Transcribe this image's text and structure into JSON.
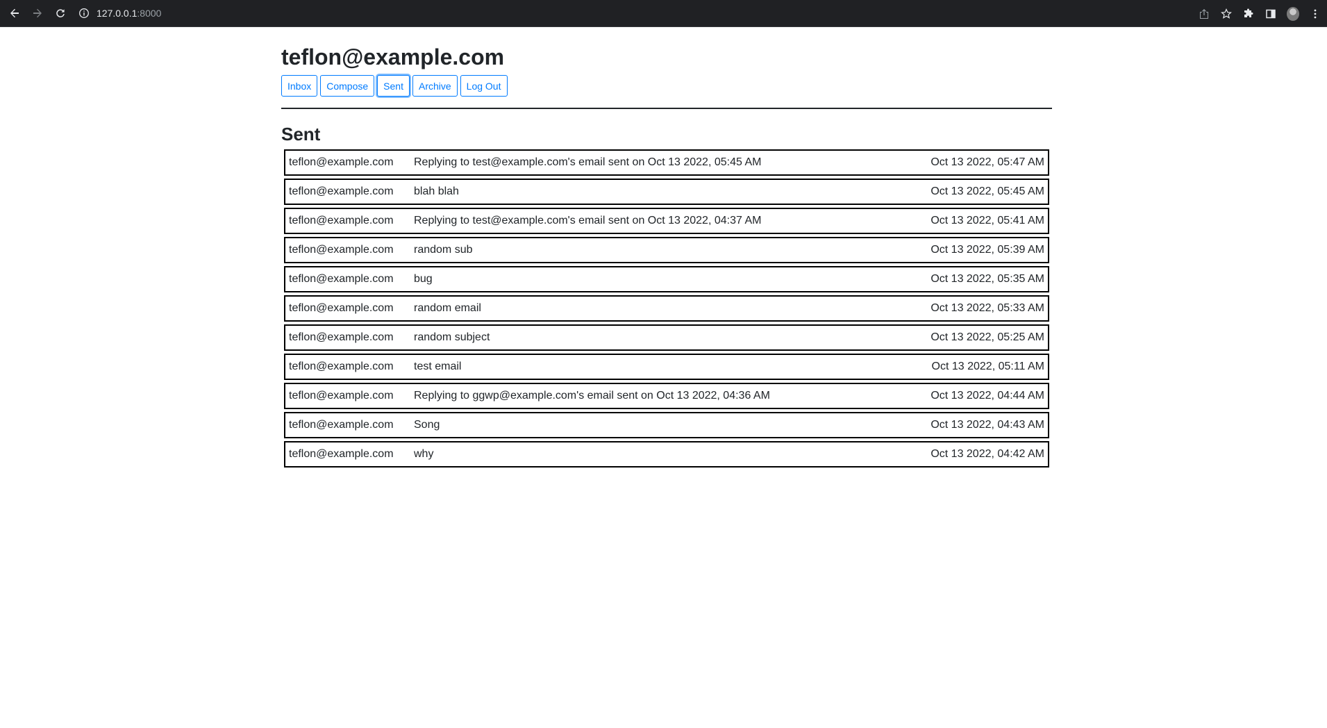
{
  "browser": {
    "url_host": "127.0.0.1",
    "url_port": ":8000"
  },
  "header": {
    "user_email": "teflon@example.com"
  },
  "nav": {
    "inbox": "Inbox",
    "compose": "Compose",
    "sent": "Sent",
    "archive": "Archive",
    "logout": "Log Out",
    "active": "sent"
  },
  "mailbox": {
    "title": "Sent",
    "emails": [
      {
        "sender": "teflon@example.com",
        "subject": "Replying to test@example.com's email sent on Oct 13 2022, 05:45 AM",
        "timestamp": "Oct 13 2022, 05:47 AM"
      },
      {
        "sender": "teflon@example.com",
        "subject": "blah blah",
        "timestamp": "Oct 13 2022, 05:45 AM"
      },
      {
        "sender": "teflon@example.com",
        "subject": "Replying to test@example.com's email sent on Oct 13 2022, 04:37 AM",
        "timestamp": "Oct 13 2022, 05:41 AM"
      },
      {
        "sender": "teflon@example.com",
        "subject": "random sub",
        "timestamp": "Oct 13 2022, 05:39 AM"
      },
      {
        "sender": "teflon@example.com",
        "subject": "bug",
        "timestamp": "Oct 13 2022, 05:35 AM"
      },
      {
        "sender": "teflon@example.com",
        "subject": "random email",
        "timestamp": "Oct 13 2022, 05:33 AM"
      },
      {
        "sender": "teflon@example.com",
        "subject": "random subject",
        "timestamp": "Oct 13 2022, 05:25 AM"
      },
      {
        "sender": "teflon@example.com",
        "subject": "test email",
        "timestamp": "Oct 13 2022, 05:11 AM"
      },
      {
        "sender": "teflon@example.com",
        "subject": "Replying to ggwp@example.com's email sent on Oct 13 2022, 04:36 AM",
        "timestamp": "Oct 13 2022, 04:44 AM"
      },
      {
        "sender": "teflon@example.com",
        "subject": "Song",
        "timestamp": "Oct 13 2022, 04:43 AM"
      },
      {
        "sender": "teflon@example.com",
        "subject": "why",
        "timestamp": "Oct 13 2022, 04:42 AM"
      }
    ]
  }
}
